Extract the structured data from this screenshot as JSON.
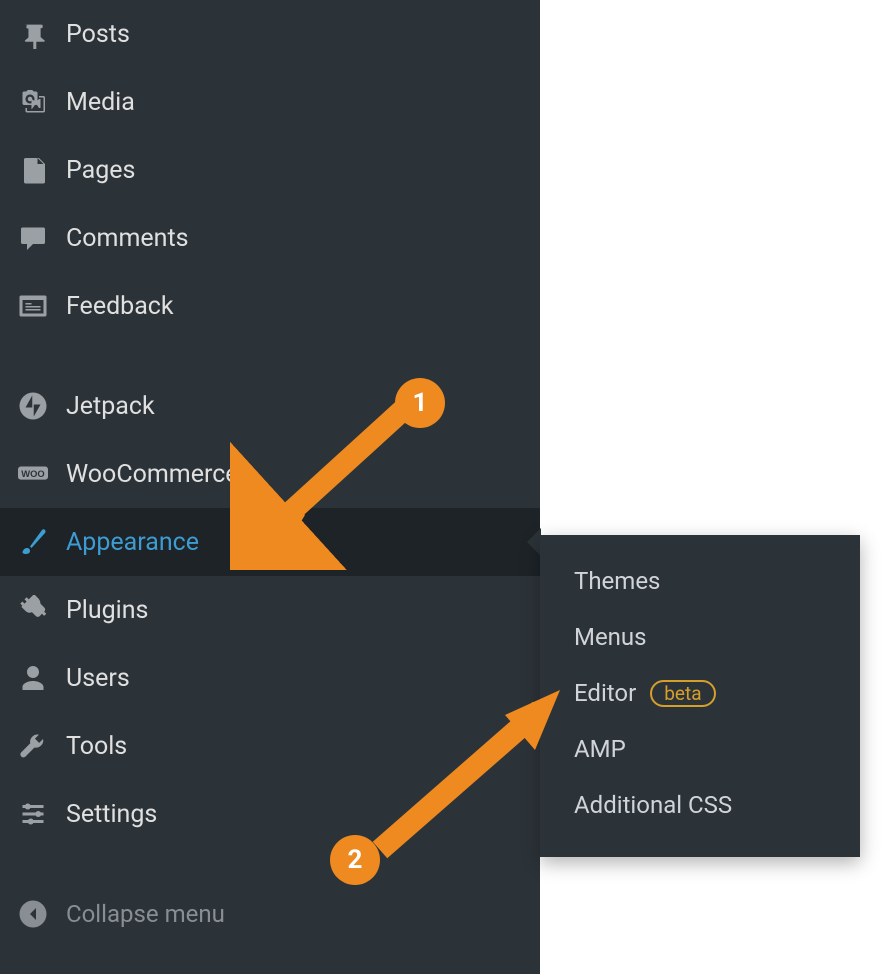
{
  "sidebar": {
    "items": [
      {
        "id": "posts",
        "label": "Posts"
      },
      {
        "id": "media",
        "label": "Media"
      },
      {
        "id": "pages",
        "label": "Pages"
      },
      {
        "id": "comments",
        "label": "Comments"
      },
      {
        "id": "feedback",
        "label": "Feedback"
      },
      {
        "id": "jetpack",
        "label": "Jetpack"
      },
      {
        "id": "woocommerce",
        "label": "WooCommerce"
      },
      {
        "id": "appearance",
        "label": "Appearance",
        "active": true
      },
      {
        "id": "plugins",
        "label": "Plugins"
      },
      {
        "id": "users",
        "label": "Users"
      },
      {
        "id": "tools",
        "label": "Tools"
      },
      {
        "id": "settings",
        "label": "Settings"
      }
    ],
    "collapse_label": "Collapse menu"
  },
  "submenu": {
    "items": [
      {
        "id": "themes",
        "label": "Themes"
      },
      {
        "id": "menus",
        "label": "Menus"
      },
      {
        "id": "editor",
        "label": "Editor",
        "badge": "beta"
      },
      {
        "id": "amp",
        "label": "AMP"
      },
      {
        "id": "additional-css",
        "label": "Additional CSS"
      }
    ]
  },
  "annotations": {
    "marker1": "1",
    "marker2": "2"
  }
}
